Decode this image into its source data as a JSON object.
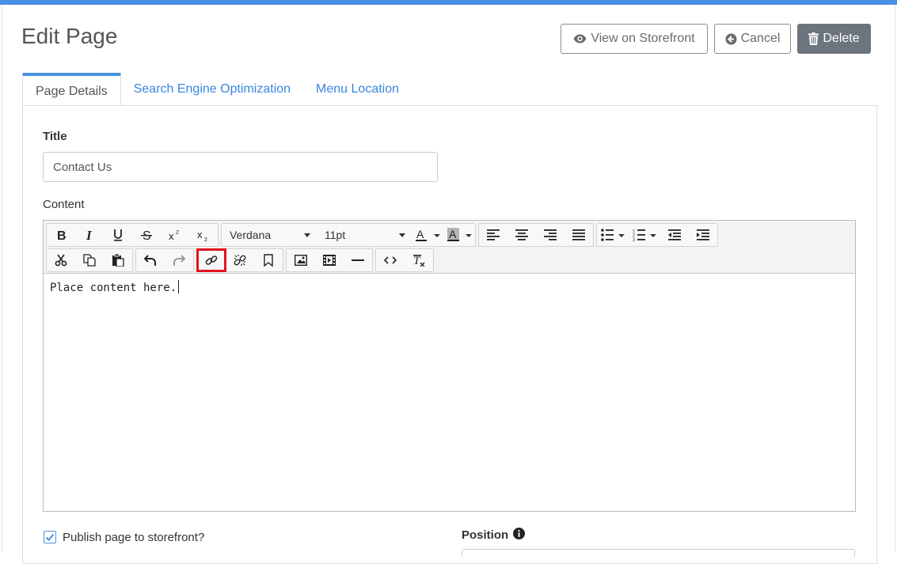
{
  "page": {
    "title": "Edit Page"
  },
  "header_buttons": {
    "view_storefront": "View on Storefront",
    "cancel": "Cancel",
    "delete": "Delete"
  },
  "tabs": [
    {
      "label": "Page Details",
      "active": true
    },
    {
      "label": "Search Engine Optimization",
      "active": false
    },
    {
      "label": "Menu Location",
      "active": false
    }
  ],
  "form": {
    "title_label": "Title",
    "title_value": "Contact Us",
    "content_label": "Content"
  },
  "editor": {
    "font_family": "Verdana",
    "font_size": "11pt",
    "content": "Place content here.",
    "highlighted_tool": "insert-link"
  },
  "publish": {
    "label": "Publish page to storefront?",
    "checked": true
  },
  "position": {
    "label": "Position"
  },
  "colors": {
    "accent": "#4a90e2",
    "delete_bg": "#6c757d",
    "highlight": "#e0141e"
  }
}
